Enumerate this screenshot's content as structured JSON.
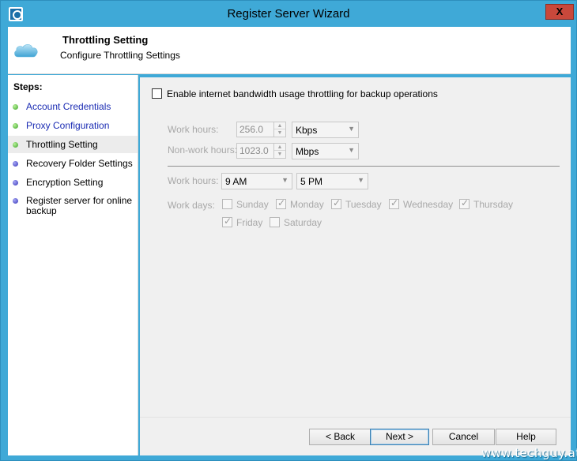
{
  "window": {
    "title": "Register Server Wizard",
    "close_label": "X"
  },
  "header": {
    "title": "Throttling Setting",
    "subtitle": "Configure Throttling Settings"
  },
  "steps": {
    "title": "Steps:",
    "items": [
      {
        "label": "Account Credentials",
        "status": "done"
      },
      {
        "label": "Proxy Configuration",
        "status": "done"
      },
      {
        "label": "Throttling Setting",
        "status": "current"
      },
      {
        "label": "Recovery Folder Settings",
        "status": "pending"
      },
      {
        "label": "Encryption Setting",
        "status": "pending"
      },
      {
        "label": "Register server for online backup",
        "status": "pending"
      }
    ]
  },
  "throttling": {
    "enable_label": "Enable internet bandwidth usage throttling for backup operations",
    "enable_checked": false,
    "work_hours_label": "Work hours:",
    "work_hours_value": "256.0",
    "work_hours_unit": "Kbps",
    "nonwork_hours_label": "Non-work hours:",
    "nonwork_hours_value": "1023.0",
    "nonwork_hours_unit": "Mbps",
    "schedule_label": "Work hours:",
    "start_time": "9 AM",
    "end_time": "5 PM",
    "work_days_label": "Work days:",
    "days": [
      {
        "label": "Sunday",
        "checked": false
      },
      {
        "label": "Monday",
        "checked": true
      },
      {
        "label": "Tuesday",
        "checked": true
      },
      {
        "label": "Wednesday",
        "checked": true
      },
      {
        "label": "Thursday",
        "checked": true
      },
      {
        "label": "Friday",
        "checked": true
      },
      {
        "label": "Saturday",
        "checked": false
      }
    ]
  },
  "buttons": {
    "back": "< Back",
    "next": "Next >",
    "cancel": "Cancel",
    "help": "Help"
  },
  "watermark": "www.techguy.at",
  "colors": {
    "titlebar": "#3fa9d7",
    "link": "#1a2bb3",
    "done_dot": "#3ca22a",
    "pending_dot": "#3535b8"
  }
}
